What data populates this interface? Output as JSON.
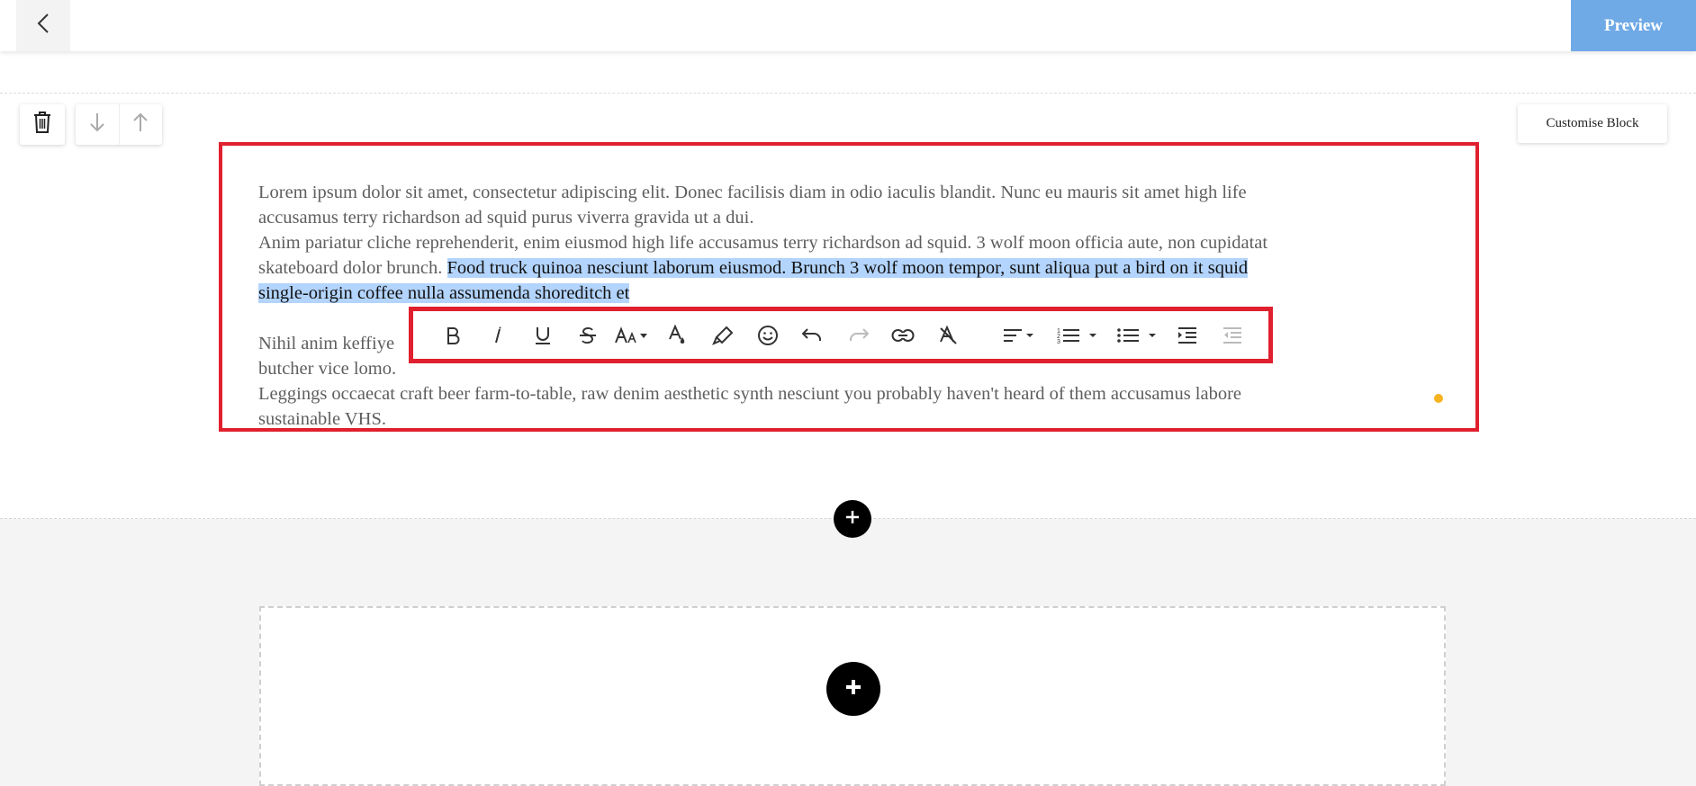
{
  "topbar": {
    "back_icon": "chevron-left-icon",
    "preview_label": "Preview"
  },
  "block_controls": {
    "delete_icon": "trash-icon",
    "move_down_icon": "arrow-down-icon",
    "move_up_icon": "arrow-up-icon",
    "customise_label": "Customise Block"
  },
  "text_block": {
    "paragraph1_line1": "Lorem ipsum dolor sit amet, consectetur adipiscing elit. Donec facilisis diam in odio iaculis blandit. Nunc eu mauris sit amet high life",
    "paragraph1_line2": "accusamus terry richardson ad squid purus viverra gravida ut a dui.",
    "paragraph2_line1": "Anim pariatur cliche reprehenderit, enim eiusmod high life accusamus terry richardson ad squid. 3 wolf moon officia aute, non cupidatat",
    "paragraph2_line2_plain": "skateboard dolor brunch. ",
    "paragraph2_line2_selected": "Food truck quinoa nesciunt laborum eiusmod. Brunch 3 wolf moon tempor, sunt aliqua put a bird on it squid",
    "paragraph2_line3_selected": "single-origin coffee nulla assumenda shoreditch et",
    "paragraph3_line1_start": "Nihil anim keffiye",
    "paragraph3_line1_end": "butcher vice lomo.",
    "paragraph3_line2": "Leggings occaecat craft beer farm-to-table, raw denim aesthetic synth nesciunt you probably haven't heard of them accusamus labore",
    "paragraph3_line3": "sustainable VHS."
  },
  "format_toolbar": {
    "buttons": [
      "bold-icon",
      "italic-icon",
      "underline-icon",
      "strikethrough-icon",
      "font-size-icon",
      "font-color-icon",
      "highlight-icon",
      "emoji-icon",
      "undo-icon",
      "redo-icon",
      "link-icon",
      "clear-format-icon",
      "align-icon",
      "ordered-list-icon",
      "unordered-list-icon",
      "indent-icon",
      "outdent-icon"
    ]
  },
  "add_section": {
    "plus_icon": "plus-icon"
  },
  "colors": {
    "preview_bg": "#6fa9e6",
    "highlight_border": "#e0202e",
    "selection": "#b3d4fc",
    "dot": "#f5b320"
  }
}
